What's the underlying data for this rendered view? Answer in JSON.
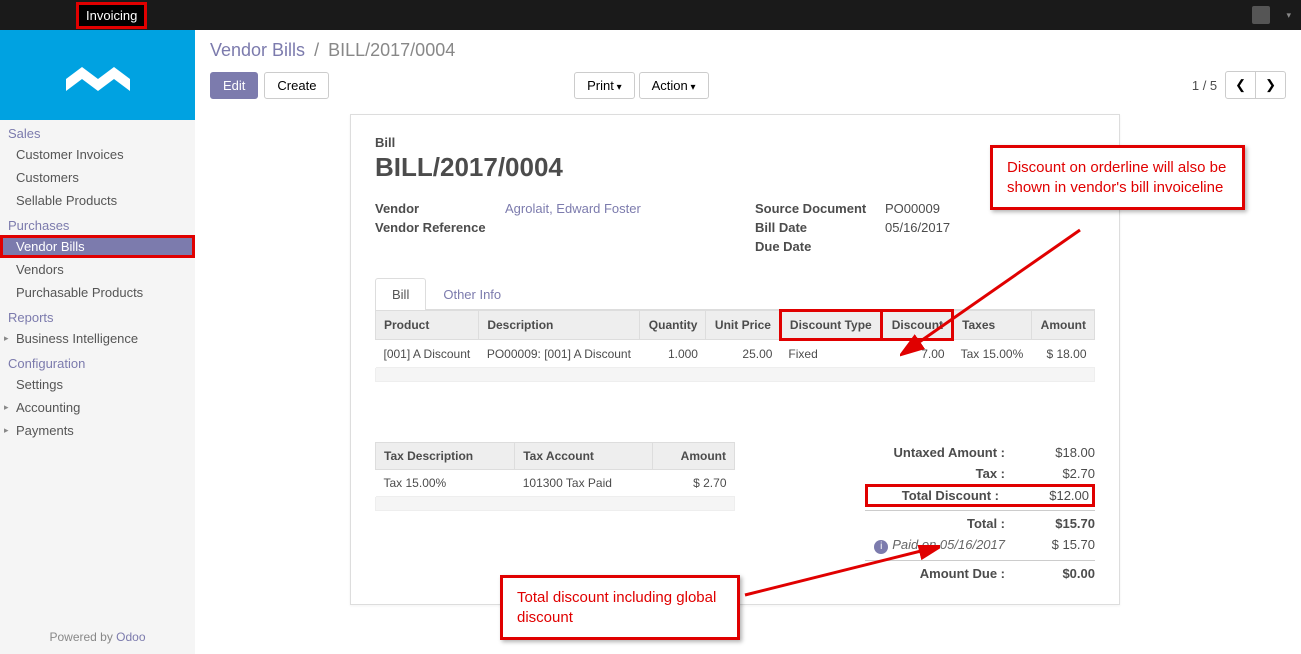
{
  "topbar": {
    "items": [
      "",
      "",
      "",
      "Invoicing",
      "",
      ""
    ],
    "active_index": 3,
    "user": ""
  },
  "sidebar": {
    "sections": [
      {
        "title": "Sales",
        "items": [
          {
            "label": "Customer Invoices",
            "active": false
          },
          {
            "label": "Customers",
            "active": false
          },
          {
            "label": "Sellable Products",
            "active": false
          }
        ]
      },
      {
        "title": "Purchases",
        "items": [
          {
            "label": "Vendor Bills",
            "active": true,
            "boxed": true
          },
          {
            "label": "Vendors",
            "active": false
          },
          {
            "label": "Purchasable Products",
            "active": false
          }
        ]
      },
      {
        "title": "Reports",
        "items": [
          {
            "label": "Business Intelligence",
            "active": false,
            "caret": true
          }
        ]
      },
      {
        "title": "Configuration",
        "items": [
          {
            "label": "Settings",
            "active": false
          },
          {
            "label": "Accounting",
            "active": false,
            "caret": true
          },
          {
            "label": "Payments",
            "active": false,
            "caret": true
          }
        ]
      }
    ],
    "footer_prefix": "Powered by ",
    "footer_link": "Odoo"
  },
  "breadcrumb": {
    "parent": "Vendor Bills",
    "current": "BILL/2017/0004"
  },
  "toolbar": {
    "edit": "Edit",
    "create": "Create",
    "print": "Print",
    "action": "Action",
    "pager": "1 / 5"
  },
  "bill": {
    "small_title": "Bill",
    "title": "BILL/2017/0004",
    "left": [
      {
        "label": "Vendor",
        "value": "Agrolait, Edward Foster",
        "link": true
      },
      {
        "label": "Vendor Reference",
        "value": ""
      }
    ],
    "right": [
      {
        "label": "Source Document",
        "value": "PO00009"
      },
      {
        "label": "Bill Date",
        "value": "05/16/2017"
      },
      {
        "label": "Due Date",
        "value": ""
      }
    ]
  },
  "tabs": [
    {
      "label": "Bill",
      "active": true
    },
    {
      "label": "Other Info",
      "active": false
    }
  ],
  "line_headers": [
    "Product",
    "Description",
    "Quantity",
    "Unit Price",
    "Discount Type",
    "Discount",
    "Taxes",
    "Amount"
  ],
  "lines": [
    {
      "product": "[001] A Discount",
      "description": "PO00009: [001] A Discount",
      "quantity": "1.000",
      "unit_price": "25.00",
      "discount_type": "Fixed",
      "discount": "7.00",
      "taxes": "Tax 15.00%",
      "amount": "$ 18.00"
    }
  ],
  "tax_headers": [
    "Tax Description",
    "Tax Account",
    "Amount"
  ],
  "tax_lines": [
    {
      "desc": "Tax 15.00%",
      "account": "101300 Tax Paid",
      "amount": "$ 2.70"
    }
  ],
  "totals": {
    "untaxed_label": "Untaxed Amount :",
    "untaxed": "$18.00",
    "tax_label": "Tax :",
    "tax": "$2.70",
    "discount_label": "Total Discount :",
    "discount": "$12.00",
    "total_label": "Total :",
    "total": "$15.70",
    "paid_label": "Paid on 05/16/2017",
    "paid": "$ 15.70",
    "due_label": "Amount Due :",
    "due": "$0.00"
  },
  "annotations": {
    "callout1": "Discount on orderline will also be  shown in vendor's bill invoiceline",
    "callout2": "Total discount including global discount"
  },
  "colors": {
    "accent": "#7c7bad",
    "brand": "#00a2e1",
    "annotation": "#e00000"
  }
}
